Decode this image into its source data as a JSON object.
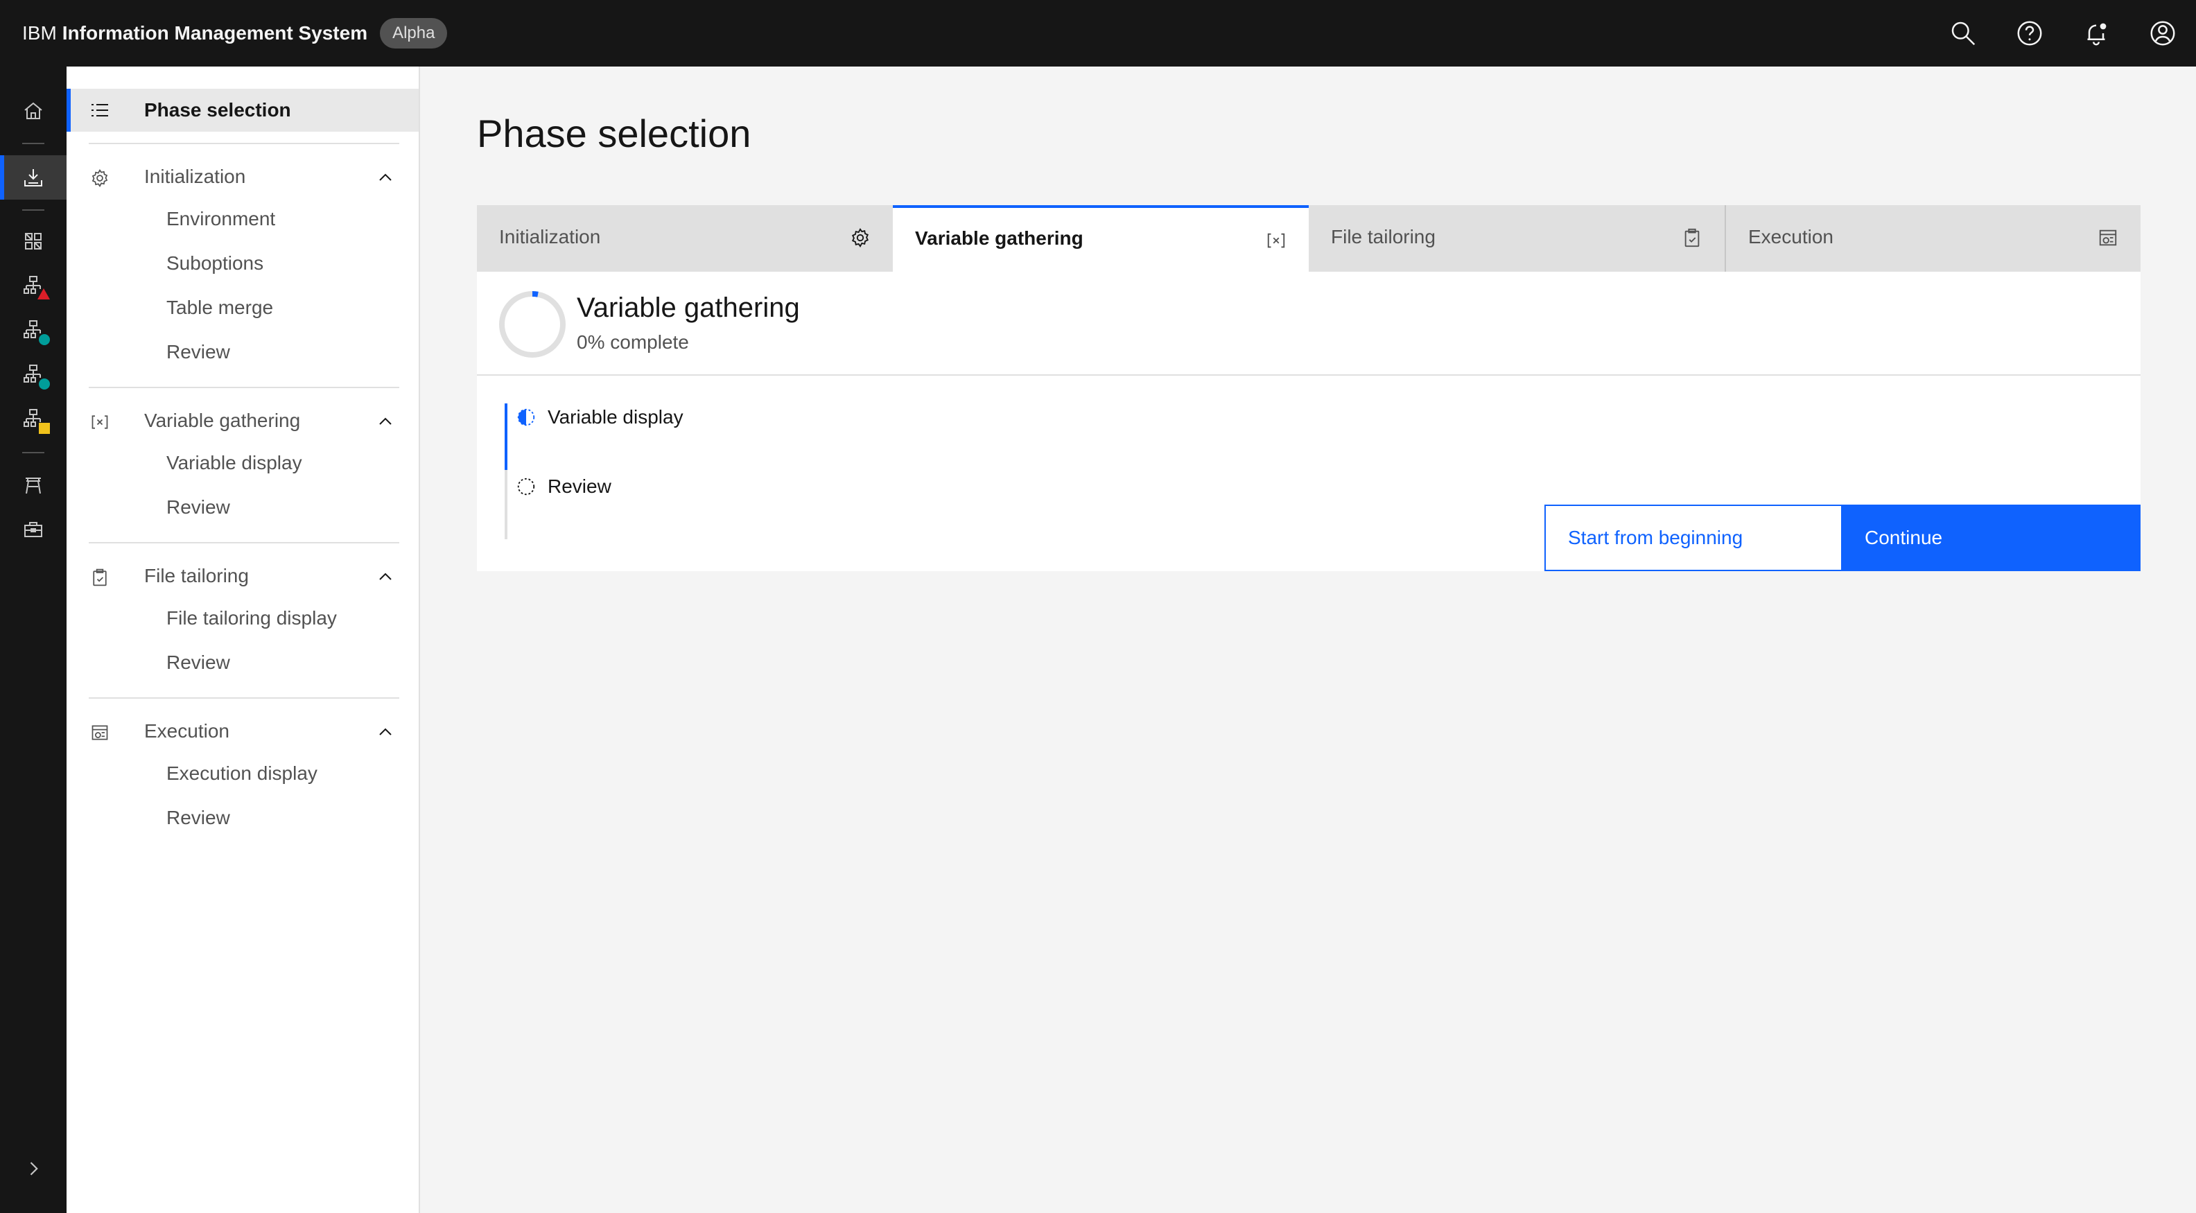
{
  "header": {
    "company": "IBM",
    "product": "Information Management System",
    "tag": "Alpha",
    "actions": [
      {
        "icon": "search-icon"
      },
      {
        "icon": "help-icon"
      },
      {
        "icon": "notification-icon"
      },
      {
        "icon": "user-avatar-icon"
      }
    ]
  },
  "rail": {
    "items": [
      {
        "icon": "home-icon"
      },
      {
        "icon": "install-icon",
        "active": true
      },
      {
        "icon": "dashboard-icon"
      },
      {
        "icon": "hierarchy-icon",
        "status": "#da1e28"
      },
      {
        "icon": "hierarchy-icon",
        "status": "#009d9a"
      },
      {
        "icon": "hierarchy-icon",
        "status": "#009d9a"
      },
      {
        "icon": "hierarchy-icon",
        "status": "#f1c21b"
      },
      {
        "icon": "gateway-icon"
      },
      {
        "icon": "toolbox-icon"
      },
      {
        "icon": "expand-icon"
      }
    ]
  },
  "side_nav": {
    "title": "Phase selection",
    "sections": [
      {
        "title": "Initialization",
        "icon": "settings-icon",
        "items": [
          "Environment",
          "Suboptions",
          "Table merge",
          "Review"
        ]
      },
      {
        "title": "Variable gathering",
        "icon": "variable-icon",
        "items": [
          "Variable display",
          "Review"
        ]
      },
      {
        "title": "File tailoring",
        "icon": "clipboard-icon",
        "items": [
          "File tailoring display",
          "Review"
        ]
      },
      {
        "title": "Execution",
        "icon": "execution-icon",
        "items": [
          "Execution display",
          "Review"
        ]
      }
    ]
  },
  "main": {
    "title": "Phase selection",
    "tabs": [
      {
        "label": "Initialization",
        "icon": "settings-icon"
      },
      {
        "label": "Variable gathering",
        "icon": "variable-icon",
        "selected": true
      },
      {
        "label": "File tailoring",
        "icon": "clipboard-icon"
      },
      {
        "label": "Execution",
        "icon": "execution-icon"
      }
    ],
    "phase": {
      "title": "Variable gathering",
      "progress_text": "0% complete",
      "progress_value": 0,
      "steps": [
        {
          "label": "Variable display",
          "state": "in-progress"
        },
        {
          "label": "Review",
          "state": "not-started"
        }
      ]
    },
    "buttons": {
      "secondary": "Start from beginning",
      "primary": "Continue"
    }
  },
  "colors": {
    "accent": "#0f62fe",
    "header_bg": "#161616",
    "page_bg": "#f4f4f4"
  }
}
